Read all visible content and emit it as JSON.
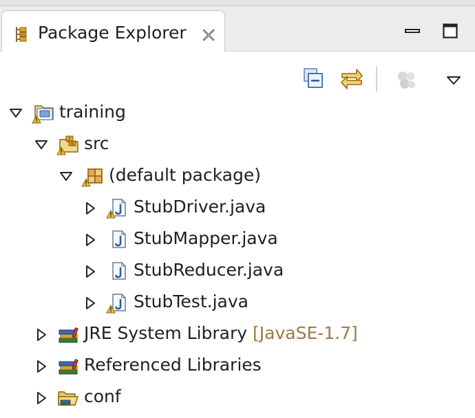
{
  "tab": {
    "title": "Package Explorer",
    "icon": "package-explorer-icon",
    "close_icon": "close-icon"
  },
  "window_controls": {
    "minimize_icon": "minimize-icon",
    "maximize_icon": "maximize-icon"
  },
  "toolbar": [
    {
      "icon": "collapse-all-icon",
      "enabled": true
    },
    {
      "icon": "link-with-editor-icon",
      "enabled": true
    },
    {
      "icon": "focus-on-active-task-icon",
      "enabled": false
    },
    {
      "icon": "view-menu-chevron-icon",
      "enabled": true
    }
  ],
  "tree": {
    "project": {
      "label": "training",
      "expanded": true,
      "icon": "java-project-warning-icon"
    },
    "src": {
      "label": "src",
      "expanded": true,
      "icon": "source-folder-warning-icon"
    },
    "package": {
      "label": "(default package)",
      "expanded": true,
      "icon": "package-warning-icon"
    },
    "files": [
      {
        "label": "StubDriver.java",
        "warning": true,
        "icon": "java-file-icon"
      },
      {
        "label": "StubMapper.java",
        "warning": false,
        "icon": "java-file-icon"
      },
      {
        "label": "StubReducer.java",
        "warning": false,
        "icon": "java-file-icon"
      },
      {
        "label": "StubTest.java",
        "warning": true,
        "icon": "java-file-icon"
      }
    ],
    "jre": {
      "label": "JRE System Library",
      "decoration": "[JavaSE-1.7]",
      "icon": "library-icon"
    },
    "referenced": {
      "label": "Referenced Libraries",
      "icon": "library-icon"
    },
    "conf": {
      "label": "conf",
      "icon": "folder-icon"
    }
  },
  "colors": {
    "warning": "#f2c230",
    "java_blue": "#3a6ea5",
    "decoration": "#9b7a44",
    "library_green": "#3a7a3a"
  }
}
